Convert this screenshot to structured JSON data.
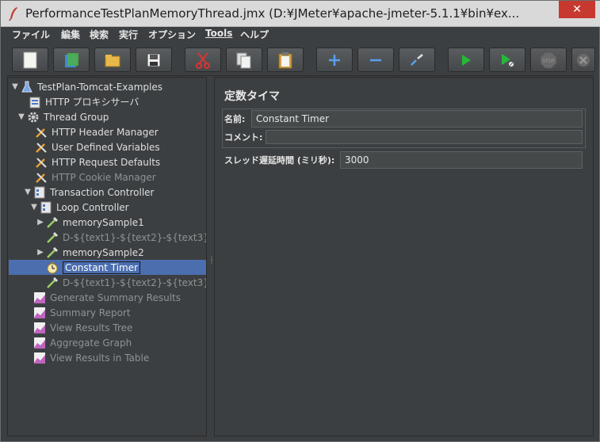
{
  "window": {
    "title": "PerformanceTestPlanMemoryThread.jmx (D:¥JMeter¥apache-jmeter-5.1.1¥bin¥ex...",
    "close_label": "✕"
  },
  "menu": [
    "ファイル",
    "編集",
    "検索",
    "実行",
    "オプション",
    "Tools",
    "ヘルプ"
  ],
  "toolbar": {
    "buttons": [
      "new-icon",
      "templates-icon",
      "open-icon",
      "save-icon",
      "cut-icon",
      "copy-icon",
      "paste-icon",
      "expand-icon",
      "collapse-icon",
      "toggle-icon",
      "start-icon",
      "start-no-pause-icon",
      "stop-icon",
      "shutdown-icon"
    ]
  },
  "tree": {
    "nodes": [
      {
        "label": "TestPlan-Tomcat-Examples",
        "icon": "testplan-icon",
        "disabled": false
      },
      {
        "label": "HTTP プロキシサーバ",
        "icon": "proxy-icon",
        "disabled": false
      },
      {
        "label": "Thread Group",
        "icon": "gear-icon",
        "disabled": false
      },
      {
        "label": "HTTP Header Manager",
        "icon": "wrench-icon",
        "disabled": false
      },
      {
        "label": "User Defined Variables",
        "icon": "wrench-icon",
        "disabled": false
      },
      {
        "label": "HTTP Request Defaults",
        "icon": "wrench-icon",
        "disabled": false
      },
      {
        "label": "HTTP Cookie Manager",
        "icon": "wrench-icon",
        "disabled": true
      },
      {
        "label": "Transaction Controller",
        "icon": "controller-icon",
        "disabled": false
      },
      {
        "label": "Loop Controller",
        "icon": "controller-icon",
        "disabled": false
      },
      {
        "label": "memorySample1",
        "icon": "sampler-icon",
        "disabled": false
      },
      {
        "label": "D-${text1}-${text2}-${text3}",
        "icon": "sampler-icon",
        "disabled": true
      },
      {
        "label": "memorySample2",
        "icon": "sampler-icon",
        "disabled": false
      },
      {
        "label": "Constant Timer",
        "icon": "timer-icon",
        "disabled": false
      },
      {
        "label": "D-${text1}-${text2}-${text3}",
        "icon": "sampler-icon",
        "disabled": true
      },
      {
        "label": "Generate Summary Results",
        "icon": "listener-icon",
        "disabled": true
      },
      {
        "label": "Summary Report",
        "icon": "listener-icon",
        "disabled": true
      },
      {
        "label": "View Results Tree",
        "icon": "listener-icon",
        "disabled": true
      },
      {
        "label": "Aggregate Graph",
        "icon": "listener-icon",
        "disabled": true
      },
      {
        "label": "View Results in Table",
        "icon": "listener-icon",
        "disabled": true
      }
    ],
    "selected_label": "Constant Timer"
  },
  "panel": {
    "title": "定数タイマ",
    "name_label": "名前:",
    "name_value": "Constant Timer",
    "comment_label": "コメント:",
    "comment_value": "",
    "delay_label": "スレッド遅延時間 (ミリ秒):",
    "delay_value": "3000"
  },
  "colors": {
    "background": "#3c3f41",
    "selection": "#4b6eaf",
    "text": "#dedede",
    "disabled_text": "#8f9294"
  }
}
